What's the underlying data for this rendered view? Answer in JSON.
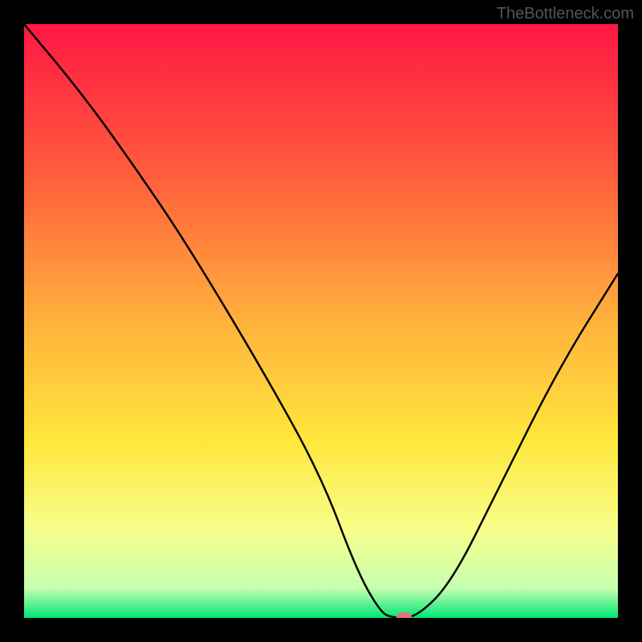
{
  "watermark": "TheBottleneck.com",
  "chart_data": {
    "type": "line",
    "title": "",
    "xlabel": "",
    "ylabel": "",
    "xlim": [
      0,
      100
    ],
    "ylim": [
      0,
      100
    ],
    "gradient_stops": [
      {
        "offset": 0,
        "color": "#ff1744"
      },
      {
        "offset": 25,
        "color": "#ff5c3c"
      },
      {
        "offset": 50,
        "color": "#ffb13c"
      },
      {
        "offset": 70,
        "color": "#ffe63c"
      },
      {
        "offset": 85,
        "color": "#f7ff8a"
      },
      {
        "offset": 95,
        "color": "#c6ffb0"
      },
      {
        "offset": 100,
        "color": "#00e676"
      }
    ],
    "series": [
      {
        "name": "bottleneck-curve",
        "x": [
          0,
          10,
          20,
          28,
          40,
          50,
          56,
          60,
          62,
          66,
          72,
          80,
          90,
          100
        ],
        "y": [
          100,
          88,
          74,
          62,
          42,
          24,
          8,
          1,
          0,
          0,
          6,
          22,
          42,
          58
        ]
      }
    ],
    "marker": {
      "x": 64,
      "y": 0,
      "color": "#e57373"
    }
  }
}
